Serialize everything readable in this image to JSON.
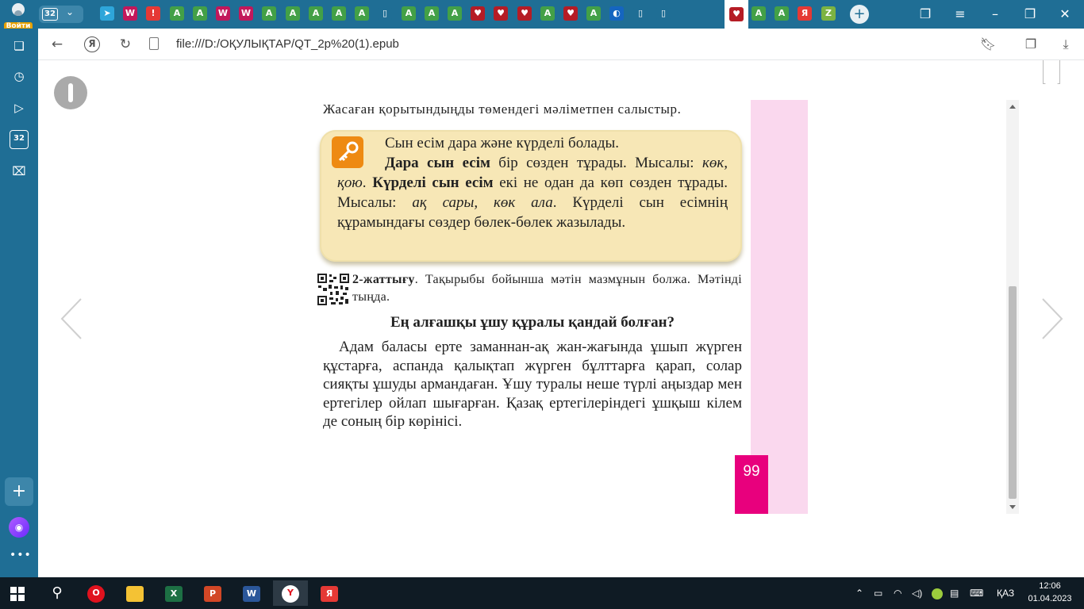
{
  "tabbar": {
    "login_label": "Войти",
    "tab_count": "32",
    "tabs": [
      {
        "icon": "telegram-icon",
        "glyph": "➤",
        "color": "#2ea6da"
      },
      {
        "icon": "doc-w-icon",
        "glyph": "W",
        "color": "#c2185b"
      },
      {
        "icon": "alert-icon",
        "glyph": "!",
        "color": "#e53935"
      },
      {
        "icon": "a-green-icon",
        "glyph": "A",
        "color": "#43a047"
      },
      {
        "icon": "a-green-icon",
        "glyph": "A",
        "color": "#43a047"
      },
      {
        "icon": "doc-w-icon",
        "glyph": "W",
        "color": "#c2185b"
      },
      {
        "icon": "doc-w-icon",
        "glyph": "W",
        "color": "#c2185b"
      },
      {
        "icon": "a-green-icon",
        "glyph": "A",
        "color": "#43a047"
      },
      {
        "icon": "a-green-icon",
        "glyph": "A",
        "color": "#43a047"
      },
      {
        "icon": "a-green-icon",
        "glyph": "A",
        "color": "#43a047"
      },
      {
        "icon": "a-green-icon",
        "glyph": "A",
        "color": "#43a047"
      },
      {
        "icon": "a-green-icon",
        "glyph": "A",
        "color": "#43a047"
      },
      {
        "icon": "file-icon",
        "glyph": "▯",
        "color": "#1f6e95"
      },
      {
        "icon": "a-green-icon",
        "glyph": "A",
        "color": "#43a047"
      },
      {
        "icon": "a-green-icon",
        "glyph": "A",
        "color": "#43a047"
      },
      {
        "icon": "a-green-icon",
        "glyph": "A",
        "color": "#43a047"
      },
      {
        "icon": "shield-red-icon",
        "glyph": "♥",
        "color": "#b51c25"
      },
      {
        "icon": "shield-red-icon",
        "glyph": "♥",
        "color": "#b51c25"
      },
      {
        "icon": "shield-red-icon",
        "glyph": "♥",
        "color": "#b51c25"
      },
      {
        "icon": "a-green-icon",
        "glyph": "A",
        "color": "#43a047"
      },
      {
        "icon": "shield-red-icon",
        "glyph": "♥",
        "color": "#b51c25"
      },
      {
        "icon": "a-green-icon",
        "glyph": "A",
        "color": "#43a047"
      },
      {
        "icon": "edge-icon",
        "glyph": "◐",
        "color": "#1565c0"
      },
      {
        "icon": "file-icon",
        "glyph": "▯",
        "color": "#1f6e95"
      },
      {
        "icon": "file-icon",
        "glyph": "▯",
        "color": "#1f6e95"
      }
    ],
    "active_tab": {
      "icon": "shield-red-icon",
      "glyph": "♥"
    },
    "tabs_after": [
      {
        "icon": "a-green-icon",
        "glyph": "A",
        "color": "#43a047"
      },
      {
        "icon": "a-green-icon",
        "glyph": "A",
        "color": "#43a047"
      },
      {
        "icon": "yandex-icon",
        "glyph": "Я",
        "color": "#e53935"
      },
      {
        "icon": "z-green-icon",
        "glyph": "Z",
        "color": "#7cb342"
      }
    ]
  },
  "address": {
    "url": "file:///D:/ОҚУЛЫҚТАР/QT_2p%20(1).epub",
    "yandex_glyph": "Я"
  },
  "sidebar": {
    "badge": "32"
  },
  "book": {
    "top_line": "Жасаған қорытындыңды төмендегі мәліметпен салыстыр.",
    "rule": {
      "line1": "Сын есім дара және күрделі болады.",
      "simple_term": "Дара сын есім",
      "simple_def": " бір сөзден тұрады. Мысалы: ",
      "simple_examples": "көк, қою",
      "period1": ". ",
      "complex_term": "Күрделі сын есім",
      "complex_def": " екі не одан да көп сөзден тұрады. Мысалы: ",
      "complex_examples": "ақ сары, көк ала",
      "rest": ". Күрделі сын есімнің құрамындағы сөздер бөлек-бөлек жазылады."
    },
    "exercise": {
      "label": "2-жаттығу",
      "text": ". Тақырыбы бойынша мәтін мазмұнын болжа. Мәтінді тыңда."
    },
    "story_title": "Ең алғашқы ұшу құралы қандай болған?",
    "story_text": "Адам баласы ерте заманнан-ақ жан-жағында ұшып жүрген құстарға, аспанда қалықтап жүрген бұлттарға қарап, солар сияқты ұшуды армандаған. Ұшу туралы неше түрлі аңыздар мен ертегілер ойлап шығарған. Қазақ ертегілеріндегі ұшқыш кілем де соның бір көрінісі.",
    "page_number": "99"
  },
  "taskbar": {
    "lang": "ҚАЗ",
    "time": "12:06",
    "date": "01.04.2023"
  },
  "colors": {
    "browser_blue": "#1f6e95",
    "page_pink": "#fad8ee",
    "page_number_magenta": "#e8007d",
    "rule_box": "#f7e7b6",
    "key_orange": "#ee8a12"
  }
}
